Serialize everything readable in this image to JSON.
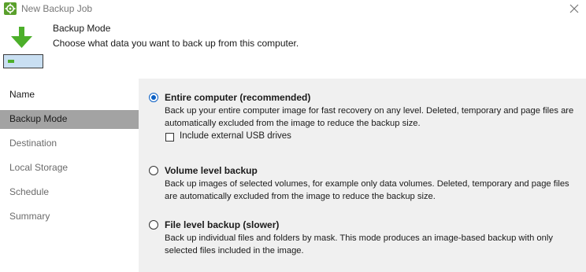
{
  "window": {
    "title": "New Backup Job"
  },
  "header": {
    "title": "Backup Mode",
    "subtitle": "Choose what data you want to back up from this computer."
  },
  "sidebar": {
    "items": [
      {
        "label": "Name",
        "state": "visited"
      },
      {
        "label": "Backup Mode",
        "state": "active"
      },
      {
        "label": "Destination",
        "state": "pending"
      },
      {
        "label": "Local Storage",
        "state": "pending"
      },
      {
        "label": "Schedule",
        "state": "pending"
      },
      {
        "label": "Summary",
        "state": "pending"
      }
    ]
  },
  "main": {
    "options": [
      {
        "title": "Entire computer (recommended)",
        "description": "Back up your entire computer image for fast recovery on any level. Deleted, temporary and page files are automatically excluded from the image to reduce the backup size.",
        "selected": true
      },
      {
        "title": "Volume level backup",
        "description": "Back up images of selected volumes, for example only data volumes. Deleted, temporary and page files are automatically excluded from the image to reduce the backup size.",
        "selected": false
      },
      {
        "title": "File level backup (slower)",
        "description": "Back up individual files and folders by mask. This mode produces an image-based backup with only selected files included in the image.",
        "selected": false
      }
    ],
    "include_usb": {
      "label": "Include external USB drives",
      "checked": false
    }
  },
  "colors": {
    "accent": "#0a5fc4",
    "active_nav": "#a3a3a3",
    "content_bg": "#f0f0f0",
    "arrow_green": "#4caf2a"
  }
}
